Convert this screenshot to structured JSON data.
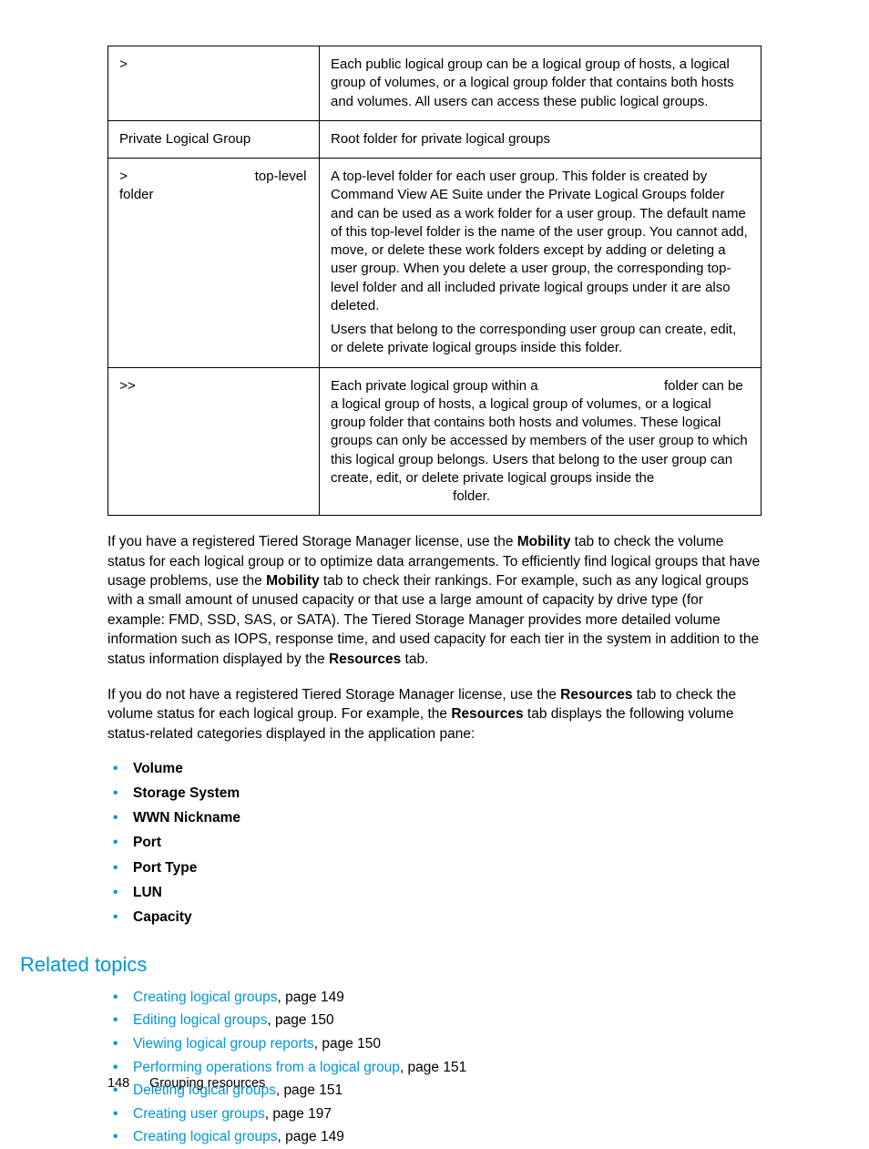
{
  "table": {
    "rows": [
      {
        "c1_html": "<span class=\"gt\">&gt;</span>",
        "c2_html": "Each public logical group can be a logical group of hosts, a logical group of volumes, or a logical group folder that contains both hosts and volumes. All users can access these public logical groups."
      },
      {
        "c1_html": "Private Logical Group",
        "c2_html": "Root folder for private logical groups"
      },
      {
        "c1_html": "<span class=\"gt\">&gt;</span><span style=\"display:inline-block;width:140px;\"></span>top-level folder",
        "c2_html": "A top-level folder for each user group. This folder is created by Command View AE Suite under the Private Logical Groups folder and can be used as a work folder for a user group. The default name of this top-level folder is the name of the user group. You cannot add, move, or delete these work folders except by adding or deleting a user group. When you delete a user group, the corresponding top-level folder and all included private logical groups under it are also deleted.<div class=\"row-spacer\"></div>Users that belong to the corresponding user group can create, edit, or delete private logical groups inside this folder."
      },
      {
        "c1_html": "<span class=\"gt\">&gt;&gt;</span>",
        "c2_html": "Each private logical group within a <span style=\"display:inline-block;width:130px;\"></span> folder can be a logical group of hosts, a logical group of volumes, or a logical group folder that contains both hosts and volumes. These logical groups can only be accessed by members of the user group to which this logical group belongs. Users that belong to the user group can create, edit, or delete private logical groups inside the <span style=\"display:inline-block;width:130px;\"></span> folder."
      }
    ]
  },
  "para1_html": "If you have a registered Tiered Storage Manager license, use the <b>Mobility</b> tab to check the volume status for each logical group or to optimize data arrangements. To efficiently find logical groups that have usage problems, use the <b>Mobility</b> tab to check their rankings. For example, such as any logical groups with a small amount of unused capacity or that use a large amount of capacity by drive type (for example: FMD, SSD, SAS, or SATA). The Tiered Storage Manager provides more detailed volume information such as IOPS, response time, and used capacity for each tier in the system in addition to the status information displayed by the <b>Resources</b> tab.",
  "para2_html": "If you do not have a registered Tiered Storage Manager license, use the <b>Resources</b> tab to check the volume status for each logical group. For example, the <b>Resources</b> tab displays the following volume status-related categories displayed in the application pane:",
  "categories": [
    "Volume",
    "Storage System",
    "WWN Nickname",
    "Port",
    "Port Type",
    "LUN",
    "Capacity"
  ],
  "related_heading": "Related topics",
  "links": [
    {
      "text": "Creating logical groups",
      "page": "149"
    },
    {
      "text": "Editing logical groups",
      "page": "150"
    },
    {
      "text": "Viewing logical group reports",
      "page": "150"
    },
    {
      "text": "Performing operations from a logical group",
      "page": "151"
    },
    {
      "text": "Deleting logical groups",
      "page": "151"
    },
    {
      "text": "Creating user groups",
      "page": "197"
    },
    {
      "text": "Creating logical groups",
      "page": "149"
    }
  ],
  "footer": {
    "page_number": "148",
    "section": "Grouping resources"
  }
}
